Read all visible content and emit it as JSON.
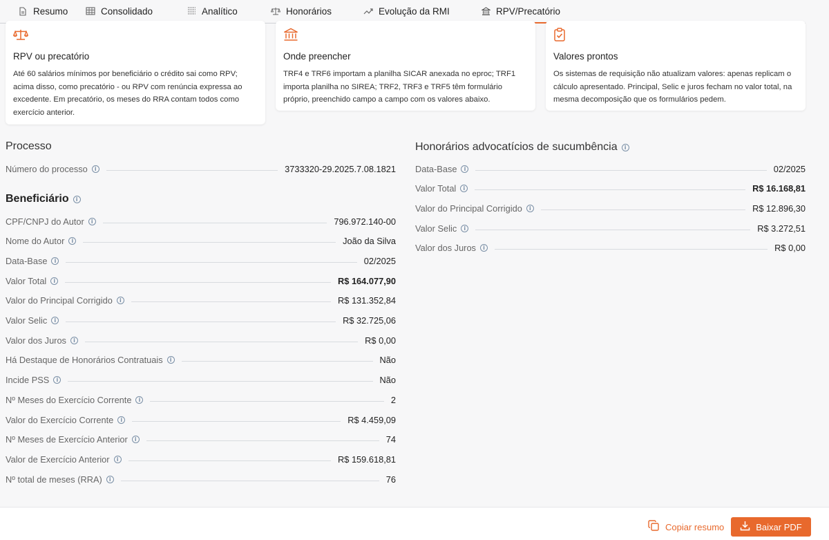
{
  "tabs": [
    {
      "label": "Resumo",
      "icon": "document-icon"
    },
    {
      "label": "Consolidado",
      "icon": "table-icon"
    },
    {
      "label": "Analítico",
      "icon": "grid-icon"
    },
    {
      "label": "Honorários",
      "icon": "scale-icon"
    },
    {
      "label": "Evolução da RMI",
      "icon": "trend-icon"
    },
    {
      "label": "RPV/Precatório",
      "icon": "bank-icon",
      "active": true
    }
  ],
  "cards": [
    {
      "icon": "scale-icon",
      "title": "RPV ou precatório",
      "text": "Até 60 salários mínimos por beneficiário o crédito sai como RPV; acima disso, como precatório - ou RPV com renúncia expressa ao excedente. Em precatório, os meses do RRA contam todos como exercício anterior."
    },
    {
      "icon": "bank-icon",
      "title": "Onde preencher",
      "text": "TRF4 e TRF6 importam a planilha SICAR anexada no eproc; TRF1 importa planilha no SIREA; TRF2, TRF3 e TRF5 têm formulário próprio, preenchido campo a campo com os valores abaixo."
    },
    {
      "icon": "clipboard-check-icon",
      "title": "Valores prontos",
      "text": "Os sistemas de requisição não atualizam valores: apenas replicam o cálculo apresentado. Principal, Selic e juros fecham no valor total, na mesma decomposição que os formulários pedem."
    }
  ],
  "processo": {
    "title": "Processo",
    "rows": [
      {
        "label": "Número do processo",
        "value": "3733320-29.2025.7.08.1821"
      }
    ]
  },
  "beneficiario": {
    "title": "Beneficiário",
    "rows": [
      {
        "label": "CPF/CNPJ do Autor",
        "value": "796.972.140-00"
      },
      {
        "label": "Nome do Autor",
        "value": "João da Silva"
      },
      {
        "label": "Data-Base",
        "value": "02/2025"
      },
      {
        "label": "Valor Total",
        "value": "R$ 164.077,90",
        "bold": true
      },
      {
        "label": "Valor do Principal Corrigido",
        "value": "R$ 131.352,84"
      },
      {
        "label": "Valor Selic",
        "value": "R$ 32.725,06"
      },
      {
        "label": "Valor dos Juros",
        "value": "R$ 0,00"
      },
      {
        "label": "Há Destaque de Honorários Contratuais",
        "value": "Não"
      },
      {
        "label": "Incide PSS",
        "value": "Não"
      },
      {
        "label": "Nº Meses do Exercício Corrente",
        "value": "2"
      },
      {
        "label": "Valor do Exercício Corrente",
        "value": "R$ 4.459,09"
      },
      {
        "label": "Nº Meses de Exercício Anterior",
        "value": "74"
      },
      {
        "label": "Valor de Exercício Anterior",
        "value": "R$ 159.618,81"
      },
      {
        "label": "Nº total de meses (RRA)",
        "value": "76"
      }
    ]
  },
  "honorarios": {
    "title": "Honorários advocatícios de sucumbência",
    "rows": [
      {
        "label": "Data-Base",
        "value": "02/2025"
      },
      {
        "label": "Valor Total",
        "value": "R$ 16.168,81",
        "bold": true
      },
      {
        "label": "Valor do Principal Corrigido",
        "value": "R$ 12.896,30"
      },
      {
        "label": "Valor Selic",
        "value": "R$ 3.272,51"
      },
      {
        "label": "Valor dos Juros",
        "value": "R$ 0,00"
      }
    ]
  },
  "footer": {
    "copy_label": "Copiar resumo",
    "pdf_label": "Baixar PDF"
  },
  "colors": {
    "accent": "#e8692d"
  }
}
